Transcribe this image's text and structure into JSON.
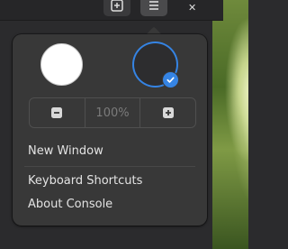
{
  "window": {
    "tab_button_icon": "new-tab-icon",
    "menu_button_icon": "hamburger-menu-icon"
  },
  "popover": {
    "style_options": [
      {
        "name": "light",
        "color": "#ffffff",
        "selected": false
      },
      {
        "name": "dark",
        "color": "#2d2d2f",
        "selected": true
      }
    ],
    "selected_check_icon": "checkmark-icon",
    "accent_color": "#3584e4",
    "zoom": {
      "decrease_icon": "zoom-out-icon",
      "value": "100%",
      "increase_icon": "zoom-in-icon"
    },
    "menu_items": [
      "New Window",
      "Keyboard Shortcuts",
      "About Console"
    ]
  }
}
